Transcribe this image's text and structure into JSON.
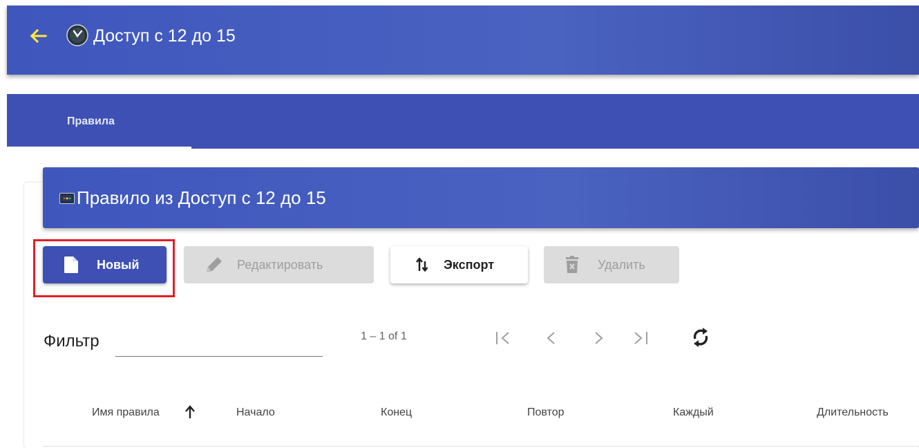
{
  "header": {
    "title": "Доступ с 12 до 15",
    "back_icon": "arrow-left-icon",
    "app_icon": "clock-icon",
    "accent_color": "#ffeb3b",
    "bar_color": "#4358ba"
  },
  "tabs": [
    {
      "label": "Правила",
      "active": true
    }
  ],
  "card": {
    "title": "Правило из Доступ с 12 до 15",
    "icon": "image-icon"
  },
  "toolbar": {
    "new": {
      "label": "Новый",
      "icon": "file-icon",
      "enabled": true
    },
    "edit": {
      "label": "Редактировать",
      "icon": "pencil-icon",
      "enabled": false
    },
    "export": {
      "label": "Экспорт",
      "icon": "sort-arrows-icon",
      "enabled": true
    },
    "delete": {
      "label": "Удалить",
      "icon": "trash-icon",
      "enabled": false
    }
  },
  "filter": {
    "label": "Фильтр",
    "value": ""
  },
  "pagination": {
    "range": "1 – 1 of 1",
    "icons": [
      "first-page-icon",
      "prev-page-icon",
      "next-page-icon",
      "last-page-icon",
      "refresh-icon"
    ]
  },
  "table": {
    "columns": [
      "Имя правила",
      "Начало",
      "Конец",
      "Повтор",
      "Каждый",
      "Длительность"
    ],
    "sort_column": "Имя правила",
    "sort_direction": "ascending"
  }
}
